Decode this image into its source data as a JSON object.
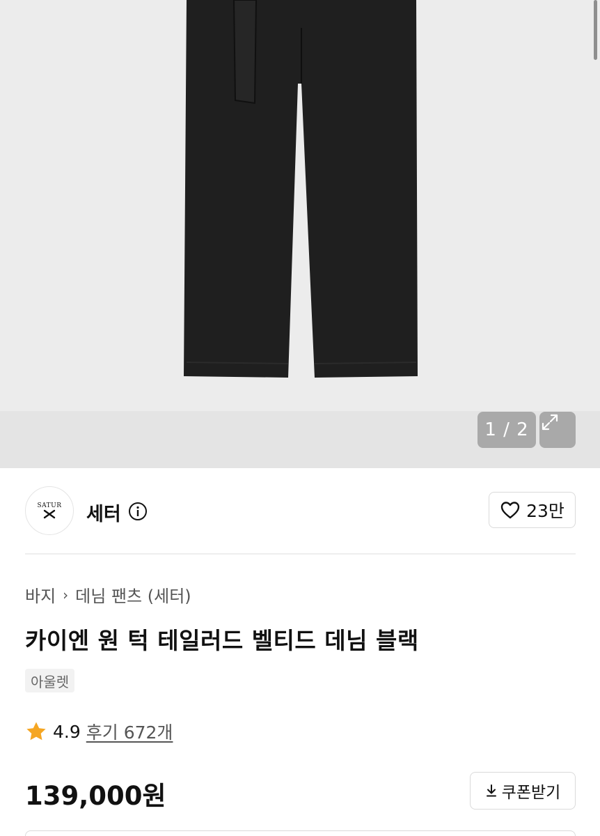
{
  "gallery": {
    "counter": "1 / 2",
    "expand_icon": "expand-icon"
  },
  "brand": {
    "logo_text": "SATUR",
    "name": "세터",
    "info_icon": "info-icon",
    "likes": "23만",
    "heart_icon": "heart-icon"
  },
  "breadcrumb": {
    "category": "바지",
    "subcategory": "데님 팬츠 (세터)"
  },
  "product": {
    "title": "카이엔 원 턱 테일러드 벨티드 데님 블랙",
    "tag": "아울렛",
    "rating": "4.9",
    "reviews": "후기 672개",
    "price": "139,000원"
  },
  "coupon": {
    "label": "쿠폰받기",
    "icon": "download-icon"
  },
  "colors": {
    "star": "#f5a623",
    "denim": "#1f1f1f",
    "background": "#ebebeb"
  }
}
